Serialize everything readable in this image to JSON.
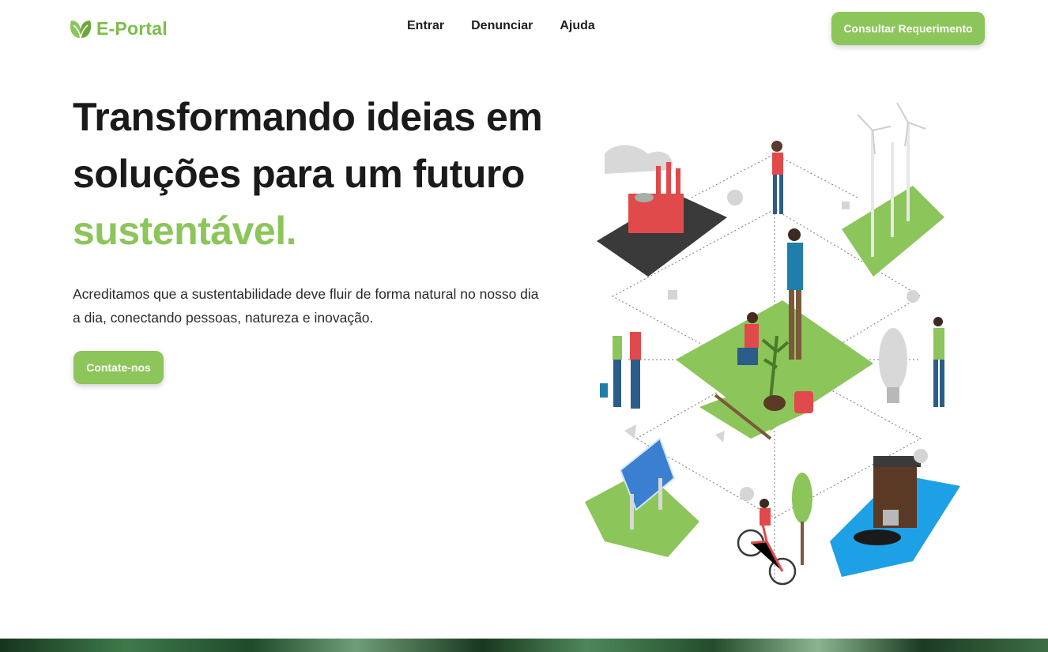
{
  "brand": {
    "name": "E-Portal",
    "icon": "leaf-logo-icon",
    "color": "#7cbd4a"
  },
  "nav": {
    "items": [
      "Entrar",
      "Denunciar",
      "Ajuda"
    ]
  },
  "header": {
    "cta_label": "Consultar Requerimento"
  },
  "hero": {
    "title_line1": "Transformando ideias em",
    "title_line2": "soluções para um futuro",
    "title_accent": "sustentável.",
    "description": "Acreditamos que a sustentabilidade deve fluir de forma natural no nosso dia a dia, conectando pessoas, natureza e inovação.",
    "cta_label": "Contate-nos"
  },
  "colors": {
    "accent": "#8cc55a",
    "text": "#1a1a1a",
    "water": "#1ea0e6"
  }
}
